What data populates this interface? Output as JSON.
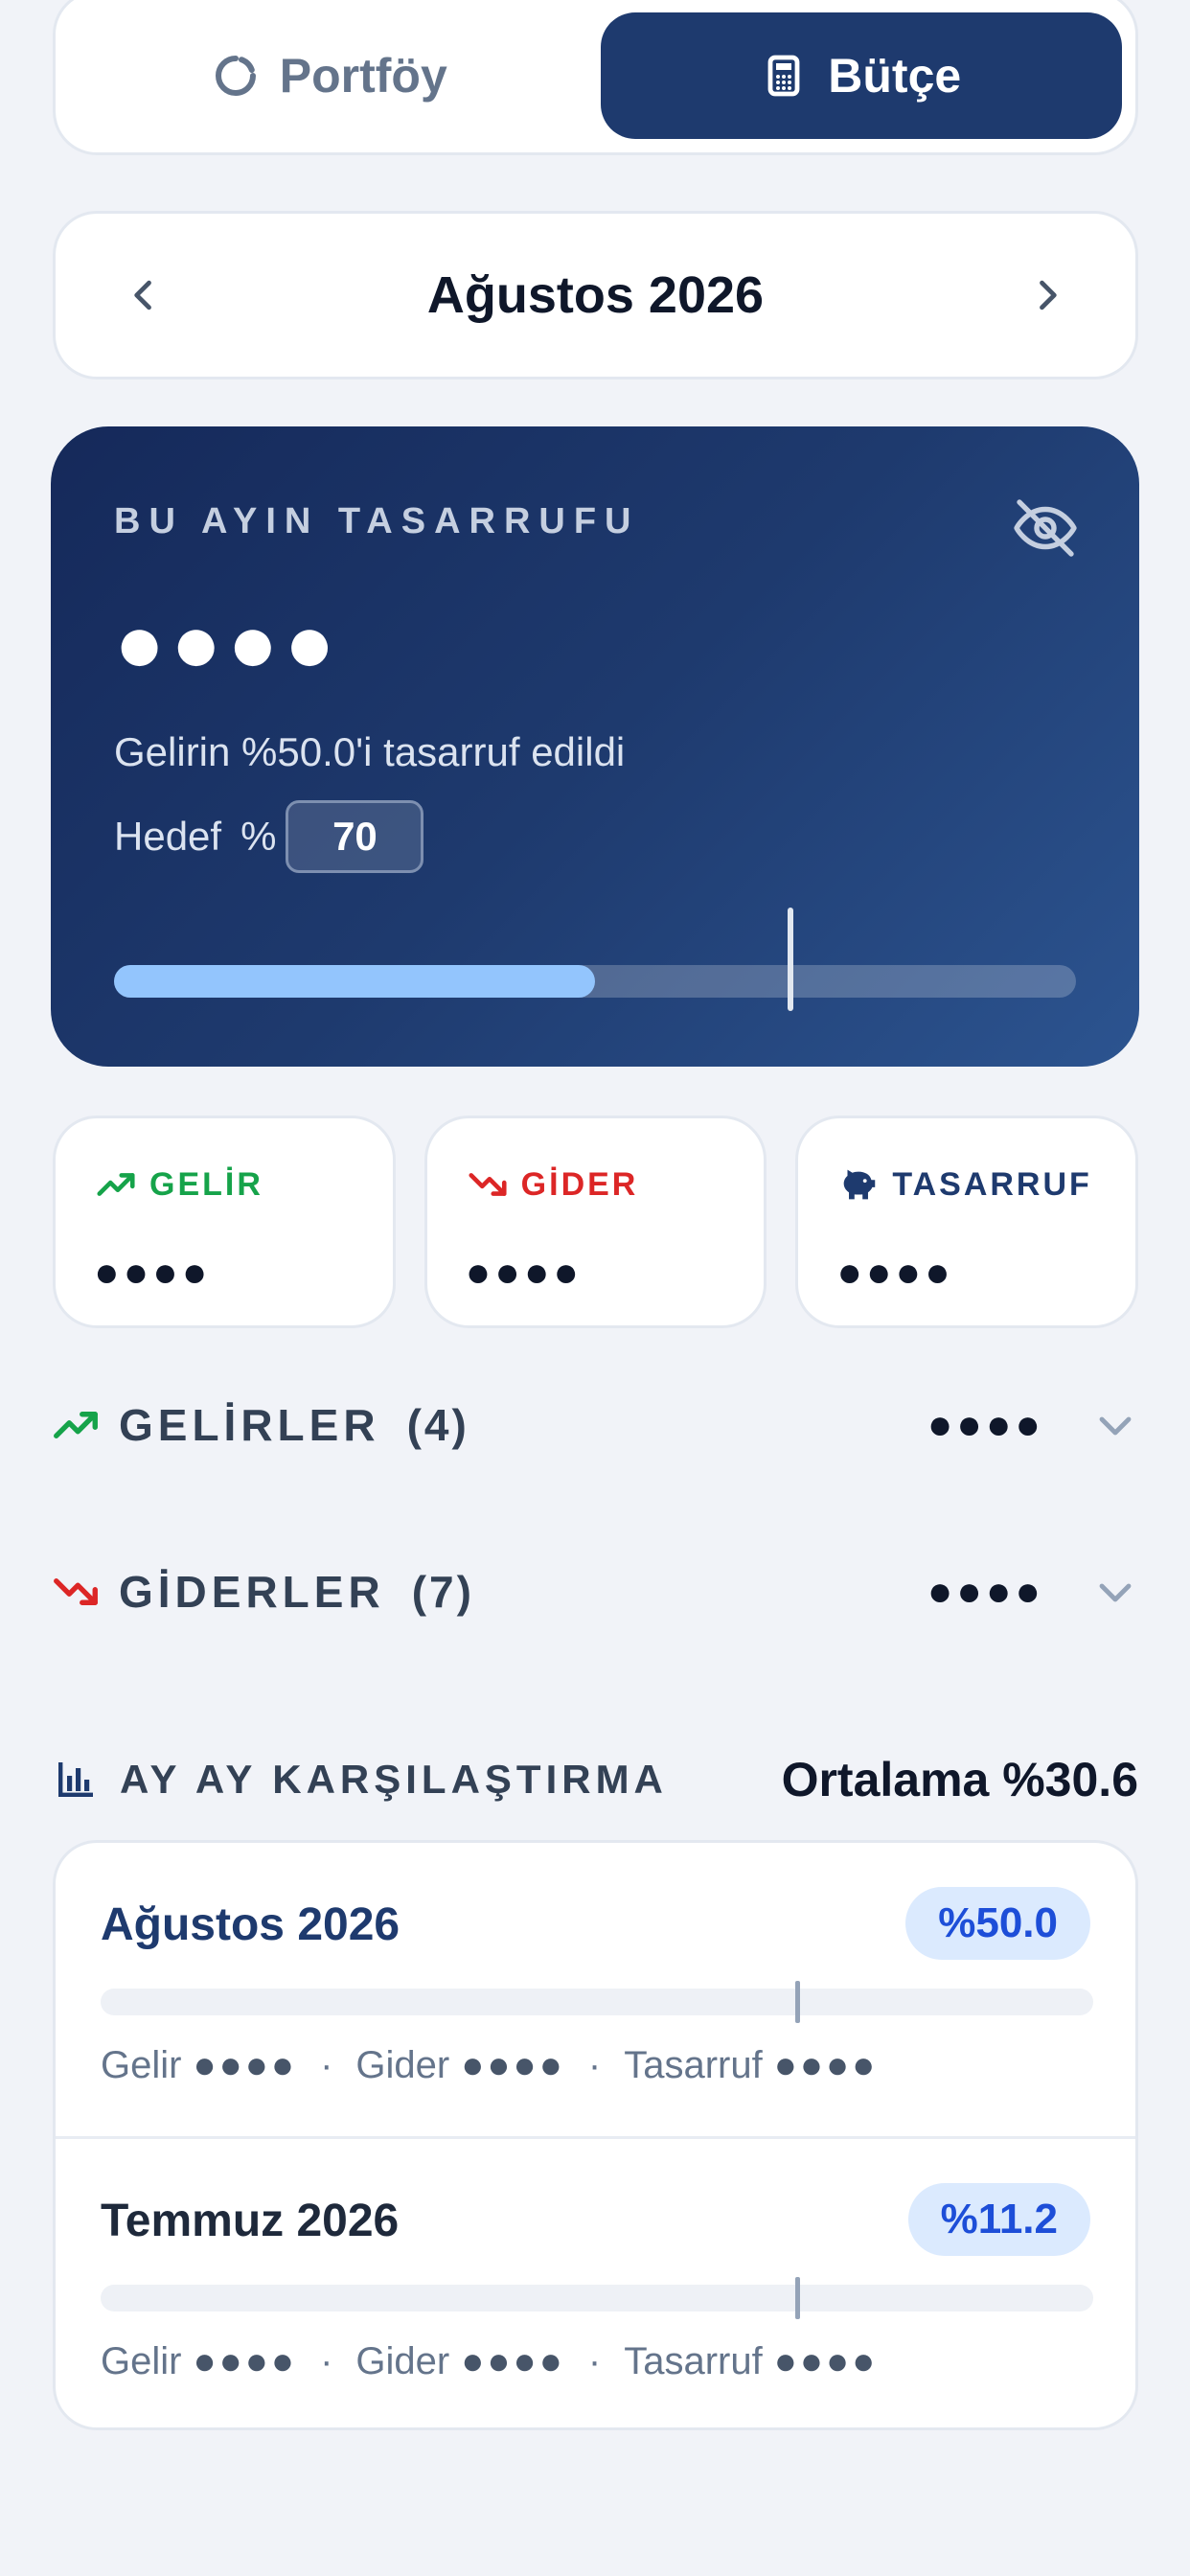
{
  "tabs": [
    {
      "label": "Portföy",
      "icon": "pie-chart-icon",
      "active": false
    },
    {
      "label": "Bütçe",
      "icon": "calculator-icon",
      "active": true
    }
  ],
  "month_nav": {
    "title": "Ağustos 2026"
  },
  "hero": {
    "label": "BU AYIN TASARRUFU",
    "amount": "●●●●",
    "subtitle": "Gelirin %50.0'i tasarruf edildi",
    "target_label": "Hedef",
    "target_prefix": "%",
    "target_value": "70",
    "progress_fraction": 0.5,
    "target_fraction": 0.7,
    "colors": {
      "fill": "#93c5fd",
      "bg_start": "#15295a",
      "bg_end": "#2c5490"
    }
  },
  "stats": [
    {
      "label": "GELİR",
      "value": "●●●●",
      "icon": "trend-up-icon",
      "color": "#16a34a"
    },
    {
      "label": "GİDER",
      "value": "●●●●",
      "icon": "trend-down-icon",
      "color": "#dc2626"
    },
    {
      "label": "TASARRUF",
      "value": "●●●●",
      "icon": "piggy-bank-icon",
      "color": "#1e3a6e"
    }
  ],
  "sections": {
    "income": {
      "title": "GELİRLER",
      "count": "(4)",
      "amount": "●●●●"
    },
    "expenses": {
      "title": "GİDERLER",
      "count": "(7)",
      "amount": "●●●●"
    }
  },
  "comparison": {
    "title": "AY AY KARŞILAŞTIRMA",
    "average": "Ortalama %30.6",
    "rows": [
      {
        "month": "Ağustos 2026",
        "badge": "%50.0",
        "target_fraction": 0.7,
        "income_label": "Gelir",
        "income_value": "●●●●",
        "expense_label": "Gider",
        "expense_value": "●●●●",
        "saving_label": "Tasarruf",
        "saving_value": "●●●●",
        "separator": "·"
      },
      {
        "month": "Temmuz 2026",
        "badge": "%11.2",
        "target_fraction": 0.7,
        "income_label": "Gelir",
        "income_value": "●●●●",
        "expense_label": "Gider",
        "expense_value": "●●●●",
        "saving_label": "Tasarruf",
        "saving_value": "●●●●",
        "separator": "·"
      }
    ]
  }
}
